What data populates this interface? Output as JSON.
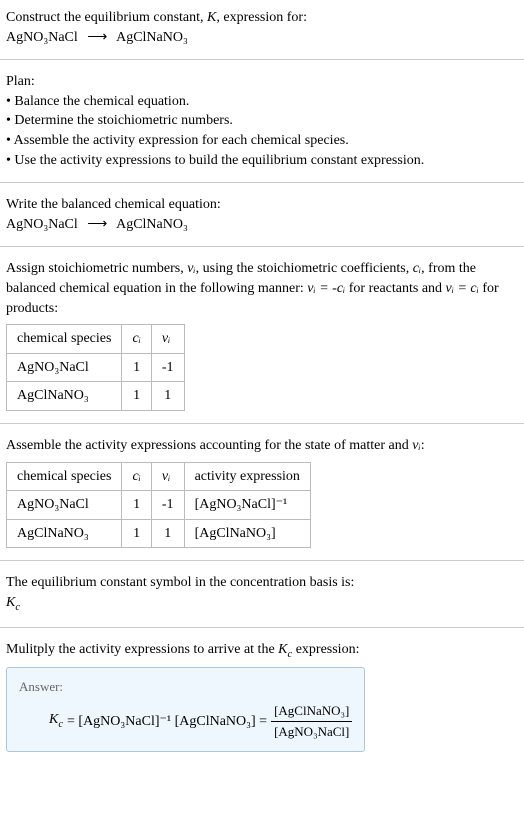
{
  "header": {
    "prompt_line1": "Construct the equilibrium constant, ",
    "k_italic": "K",
    "prompt_line1_after": ", expression for:",
    "reaction_lhs": "AgNO₃NaCl",
    "reaction_arrow": "⟶",
    "reaction_rhs": "AgClNaNO₃"
  },
  "plan": {
    "title": "Plan:",
    "items": [
      "Balance the chemical equation.",
      "Determine the stoichiometric numbers.",
      "Assemble the activity expression for each chemical species.",
      "Use the activity expressions to build the equilibrium constant expression."
    ]
  },
  "balanced": {
    "title": "Write the balanced chemical equation:",
    "lhs": "AgNO₃NaCl",
    "arrow": "⟶",
    "rhs": "AgClNaNO₃"
  },
  "assign": {
    "text_a": "Assign stoichiometric numbers, ",
    "nu_i": "νᵢ",
    "text_b": ", using the stoichiometric coefficients, ",
    "c_i": "cᵢ",
    "text_c": ", from the balanced chemical equation in the following manner: ",
    "eq1": "νᵢ = -cᵢ",
    "text_d": " for reactants and ",
    "eq2": "νᵢ = cᵢ",
    "text_e": " for products:"
  },
  "table1": {
    "headers": [
      "chemical species",
      "cᵢ",
      "νᵢ"
    ],
    "rows": [
      [
        "AgNO₃NaCl",
        "1",
        "-1"
      ],
      [
        "AgClNaNO₃",
        "1",
        "1"
      ]
    ]
  },
  "assemble": {
    "text_a": "Assemble the activity expressions accounting for the state of matter and ",
    "nu_i": "νᵢ",
    "text_b": ":"
  },
  "table2": {
    "headers": [
      "chemical species",
      "cᵢ",
      "νᵢ",
      "activity expression"
    ],
    "rows": [
      [
        "AgNO₃NaCl",
        "1",
        "-1",
        "[AgNO₃NaCl]⁻¹"
      ],
      [
        "AgClNaNO₃",
        "1",
        "1",
        "[AgClNaNO₃]"
      ]
    ]
  },
  "symbol": {
    "text": "The equilibrium constant symbol in the concentration basis is:",
    "kc": "K",
    "kc_sub": "c"
  },
  "multiply": {
    "text_a": "Mulitply the activity expressions to arrive at the ",
    "kc": "K",
    "kc_sub": "c",
    "text_b": " expression:"
  },
  "answer": {
    "label": "Answer:",
    "kc": "K",
    "kc_sub": "c",
    "eq_a": " = [AgNO₃NaCl]⁻¹ [AgClNaNO₃] = ",
    "frac_num": "[AgClNaNO₃]",
    "frac_den": "[AgNO₃NaCl]"
  }
}
